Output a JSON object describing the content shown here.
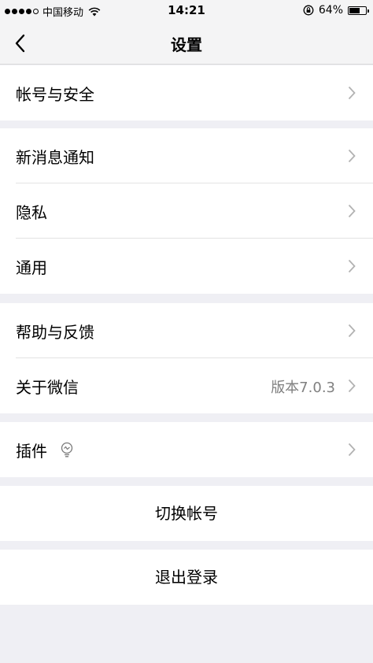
{
  "status_bar": {
    "carrier": "中国移动",
    "time": "14:21",
    "battery": "64%",
    "battery_level": 0.64
  },
  "nav": {
    "title": "设置",
    "back_icon": "chevron-left-icon"
  },
  "groups": {
    "account": {
      "items": [
        {
          "label": "帐号与安全"
        }
      ]
    },
    "notifications": {
      "items": [
        {
          "label": "新消息通知"
        },
        {
          "label": "隐私"
        },
        {
          "label": "通用"
        }
      ]
    },
    "help": {
      "items": [
        {
          "label": "帮助与反馈"
        },
        {
          "label": "关于微信",
          "value": "版本7.0.3"
        }
      ]
    },
    "plugins": {
      "items": [
        {
          "label": "插件",
          "icon": "lightbulb-icon"
        }
      ]
    }
  },
  "actions": {
    "switch_account": "切换帐号",
    "logout": "退出登录"
  },
  "colors": {
    "background": "#efeff4",
    "cell": "#ffffff",
    "secondary_text": "#808080",
    "chevron": "#b2b2b2"
  }
}
